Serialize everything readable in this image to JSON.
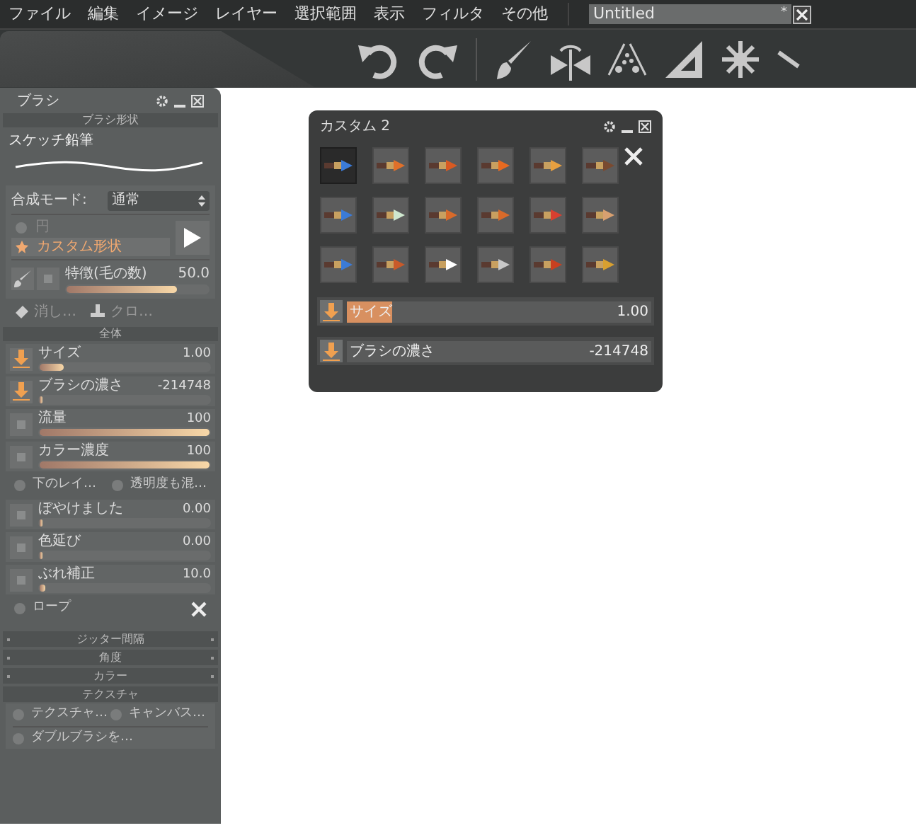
{
  "menu": [
    "ファイル",
    "編集",
    "イメージ",
    "レイヤー",
    "選択範囲",
    "表示",
    "フィルタ",
    "その他"
  ],
  "document_tab": {
    "title": "Untitled",
    "modified_mark": "*"
  },
  "brush_panel": {
    "title": "ブラシ",
    "shape_section": "ブラシ形状",
    "brush_name": "スケッチ鉛筆",
    "blend_mode_label": "合成モード:",
    "blend_mode": "通常",
    "shapes": [
      {
        "label": "円",
        "selected": false
      },
      {
        "label": "カスタム形状",
        "selected": true
      }
    ],
    "feature": {
      "label": "特徴(毛の数)",
      "value": "50.0",
      "level": 0.78
    },
    "tools": [
      "消し…",
      "クロ…"
    ],
    "overall_section": "全体",
    "params": [
      {
        "kind": "slider",
        "label": "サイズ",
        "value": "1.00",
        "level": 0.14,
        "pressure": true
      },
      {
        "kind": "slider",
        "label": "ブラシの濃さ",
        "value": "-214748",
        "level": 0,
        "pressure": true
      },
      {
        "kind": "slider",
        "label": "流量",
        "value": "100",
        "level": 1,
        "pressure": false
      },
      {
        "kind": "slider",
        "label": "カラー濃度",
        "value": "100",
        "level": 1,
        "pressure": false
      },
      {
        "kind": "options",
        "options": [
          {
            "label": "下のレイ…",
            "checked": false
          },
          {
            "label": "透明度も混…",
            "checked": false
          }
        ]
      },
      {
        "kind": "slider",
        "label": "ぼやけました",
        "value": "0.00",
        "level": 0,
        "pressure": false
      },
      {
        "kind": "slider",
        "label": "色延び",
        "value": "0.00",
        "level": 0,
        "pressure": false
      },
      {
        "kind": "slider",
        "label": "ぶれ補正",
        "value": "10.0",
        "level": 0.03,
        "pressure": false
      },
      {
        "kind": "tool_options",
        "options": [
          {
            "label": "ロープ",
            "checked": false
          }
        ]
      }
    ],
    "collapsed_sections": [
      "ジッター間隔",
      "角度",
      "カラー"
    ],
    "texture_section": "テクスチャ",
    "texture_options": [
      [
        {
          "label": "テクスチャ…",
          "checked": false
        },
        {
          "label": "キャンバス…",
          "checked": false
        }
      ],
      [
        {
          "label": "ダブルブラシを…",
          "checked": false
        }
      ]
    ]
  },
  "custom_panel": {
    "title": "カスタム 2",
    "presets": [
      {
        "selected": true
      },
      {
        "selected": false
      },
      {
        "selected": false
      },
      {
        "selected": false
      },
      {
        "selected": false
      },
      {
        "selected": false
      },
      {
        "selected": false
      },
      {
        "selected": false
      },
      {
        "selected": false
      },
      {
        "selected": false
      },
      {
        "selected": false
      },
      {
        "selected": false
      },
      {
        "selected": false
      },
      {
        "selected": false
      },
      {
        "selected": false
      },
      {
        "selected": false
      },
      {
        "selected": false
      },
      {
        "selected": false
      }
    ],
    "sliders": [
      {
        "label": "サイズ",
        "value": "1.00",
        "level": 0.15,
        "pressure": true
      },
      {
        "label": "ブラシの濃さ",
        "value": "-214748",
        "pressure": true
      }
    ]
  }
}
